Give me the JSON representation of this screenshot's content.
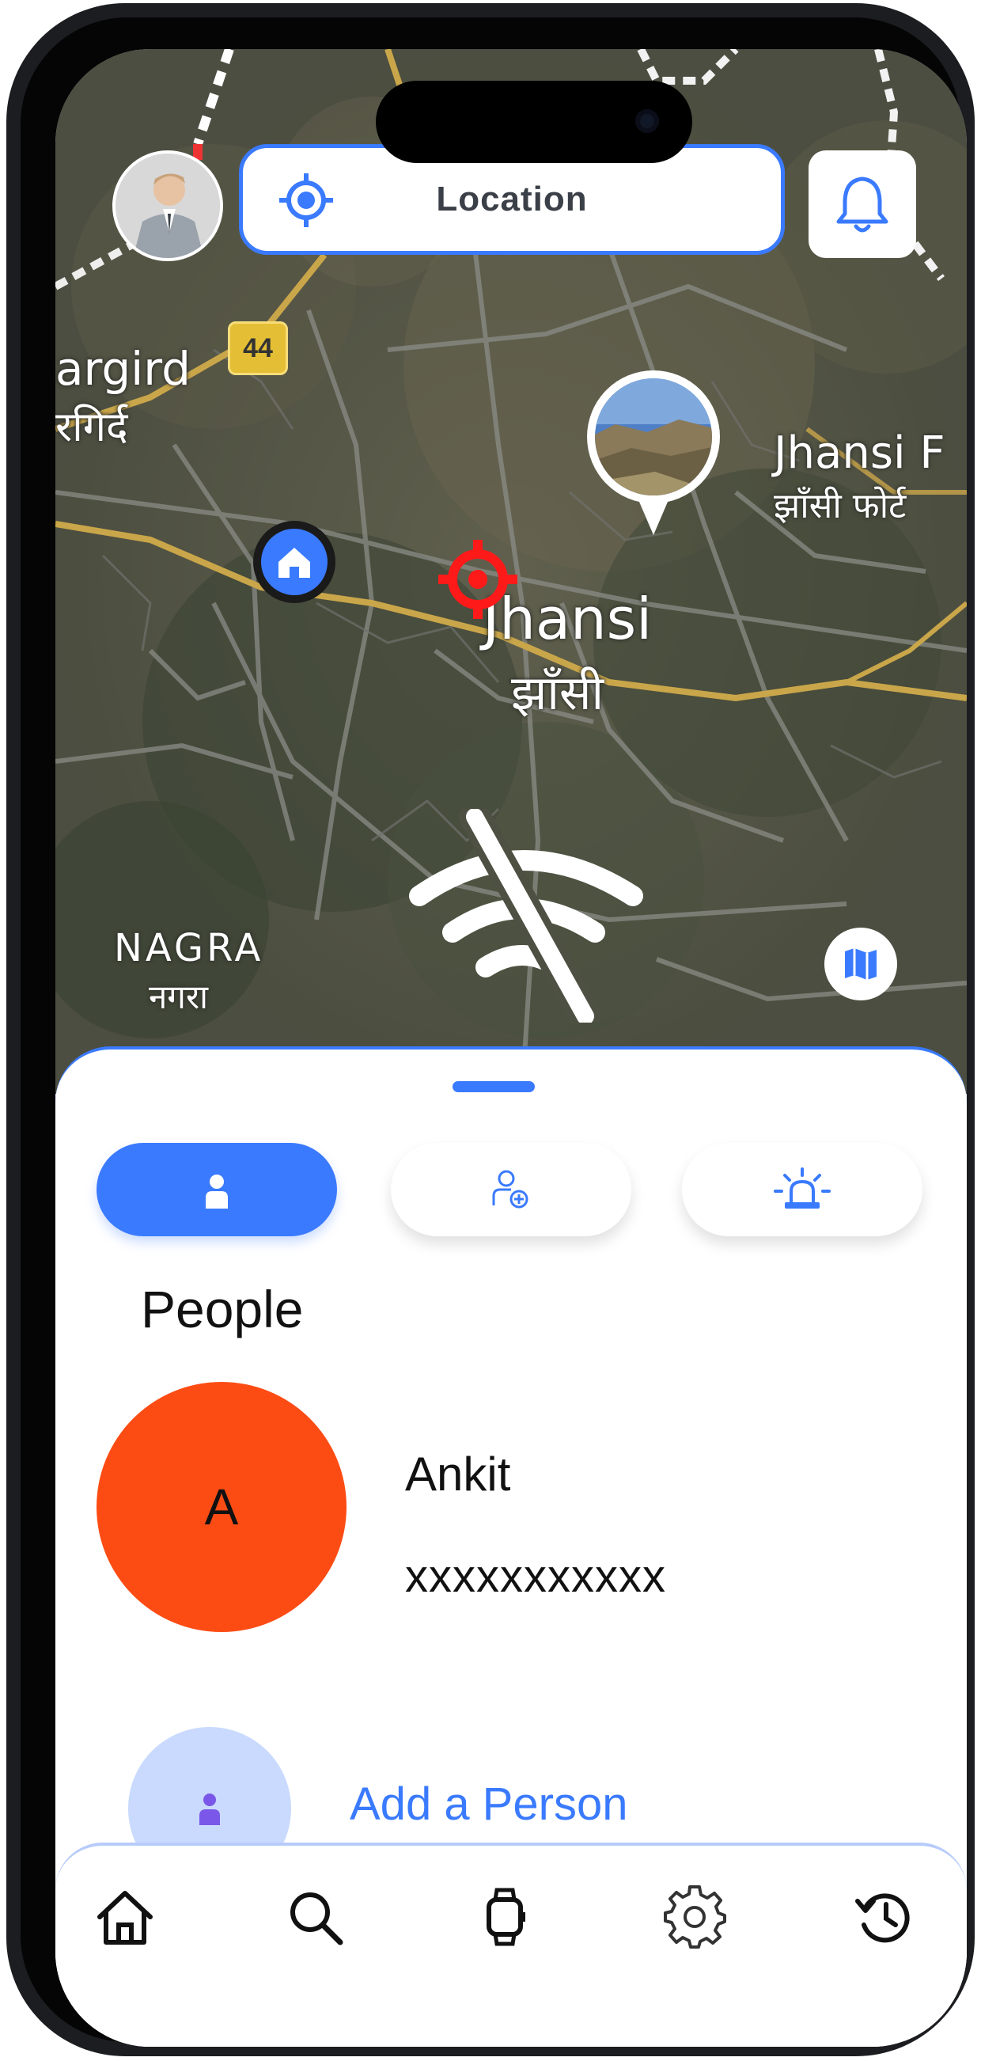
{
  "top_bar": {
    "location_label": "Location"
  },
  "map": {
    "road_badge": "44",
    "labels": [
      {
        "id": "argird",
        "text": "argird"
      },
      {
        "id": "argird-hi",
        "text": "रगिर्द"
      },
      {
        "id": "jhansi-fort",
        "text": "Jhansi F"
      },
      {
        "id": "jhansi-fort-hi",
        "text": "झाँसी फोर्ट"
      },
      {
        "id": "jhansi",
        "text": "Jhansi"
      },
      {
        "id": "jhansi-hi",
        "text": "झाँसी"
      },
      {
        "id": "nagra",
        "text": "NAGRA"
      },
      {
        "id": "nagra-hi",
        "text": "नगरा"
      }
    ]
  },
  "sheet": {
    "tabs": [
      {
        "id": "people",
        "icon": "person-icon",
        "active": true
      },
      {
        "id": "add-contact",
        "icon": "person-add-icon",
        "active": false
      },
      {
        "id": "alert",
        "icon": "siren-icon",
        "active": false
      }
    ],
    "section_title": "People",
    "people": [
      {
        "initial": "A",
        "name": "Ankit",
        "phone": "xxxxxxxxxxx",
        "avatar_color": "#fc4c14"
      }
    ],
    "add_person_label": "Add a Person"
  },
  "nav": {
    "items": [
      {
        "id": "home",
        "icon": "home-icon"
      },
      {
        "id": "search",
        "icon": "search-icon"
      },
      {
        "id": "watch",
        "icon": "watch-icon"
      },
      {
        "id": "settings",
        "icon": "gear-icon"
      },
      {
        "id": "history",
        "icon": "history-icon"
      }
    ]
  },
  "colors": {
    "accent": "#3a7afe",
    "avatar": "#fc4c14",
    "add_circle": "#c9dafe",
    "marker": "#ff1a1a"
  }
}
